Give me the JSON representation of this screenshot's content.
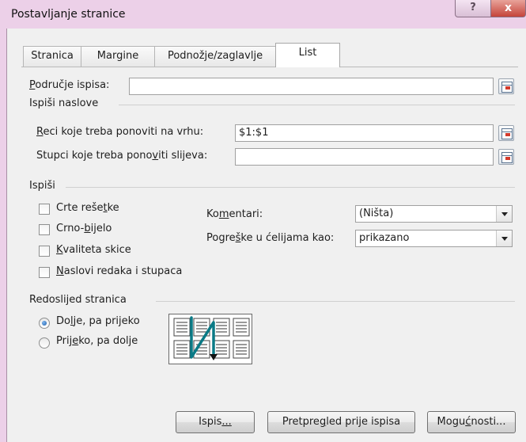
{
  "window": {
    "title": "Postavljanje stranice",
    "help_glyph": "?",
    "close_glyph": "x"
  },
  "tabs": [
    {
      "label": "Stranica"
    },
    {
      "label": "Margine"
    },
    {
      "label": "Podnožje/zaglavlje"
    },
    {
      "label": "List",
      "active": true
    }
  ],
  "print_area": {
    "label_first": "P",
    "label_rest": "odručje ispisa:",
    "value": ""
  },
  "print_titles": {
    "heading": "Ispiši naslove",
    "rows_label_first": "R",
    "rows_label_rest": "eci koje treba ponoviti na vrhu:",
    "rows_value": "$1:$1",
    "cols_label_pre": "Stupci koje treba pono",
    "cols_label_u": "v",
    "cols_label_post": "iti slijeva:",
    "cols_value": ""
  },
  "print": {
    "heading": "Ispiši",
    "gridlines": {
      "pre": "Crte reše",
      "u": "t",
      "post": "ke"
    },
    "bw": {
      "pre": "Crno-",
      "u": "b",
      "post": "ijelo"
    },
    "draft": {
      "pre": "",
      "u": "K",
      "post": "valiteta skice"
    },
    "headings": {
      "pre": "",
      "u": "N",
      "post": "aslovi redaka i stupaca"
    },
    "comments_label_pre": "Ko",
    "comments_label_u": "m",
    "comments_label_post": "entari:",
    "comments_value": "(Ništa)",
    "errors_label_pre": "Pogre",
    "errors_label_u": "š",
    "errors_label_post": "ke u ćelijama kao:",
    "errors_value": "prikazano"
  },
  "page_order": {
    "heading": "Redoslijed stranica",
    "down_over": {
      "pre": "Do",
      "u": "l",
      "post": "je, pa prijeko"
    },
    "over_down": {
      "pre": "Prij",
      "u": "e",
      "post": "ko, pa dolje"
    },
    "selected": "down_over"
  },
  "buttons": {
    "print": {
      "pre": "Ispis",
      "u": "...",
      "post": ""
    },
    "preview": {
      "pre": "Pretpre",
      "u": "g",
      "post": "led prije ispisa"
    },
    "options": {
      "pre": "Mogu",
      "u": "ć",
      "post": "nosti..."
    }
  },
  "colors": {
    "accent": "#0a7a86",
    "frame": "#ecd0e8",
    "close": "#c5443a"
  }
}
